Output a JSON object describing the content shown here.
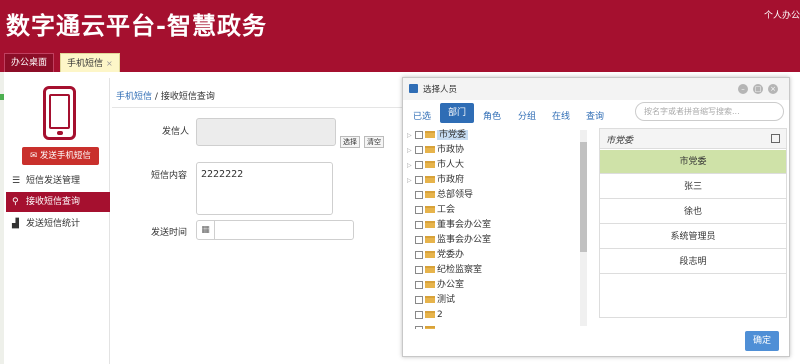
{
  "header": {
    "app_title": "数字通云平台-智慧政务",
    "user_menu": "个人办公"
  },
  "tabs": [
    {
      "label": "办公桌面",
      "active": false
    },
    {
      "label": "手机短信",
      "active": true,
      "close": "×"
    }
  ],
  "sidebar": {
    "send_button": "发送手机短信",
    "items": [
      {
        "label": "短信发送管理",
        "icon": "list-icon",
        "active": false
      },
      {
        "label": "接收短信查询",
        "icon": "search-icon",
        "active": true
      },
      {
        "label": "发送短信统计",
        "icon": "bar-chart-icon",
        "active": false
      }
    ]
  },
  "breadcrumb": {
    "link": "手机短信",
    "separator": "/",
    "current": "接收短信查询"
  },
  "form": {
    "sender_label": "发信人",
    "sender_value": "",
    "select_button": "选择",
    "clear_button": "清空",
    "content_label": "短信内容",
    "content_value": "2222222",
    "time_label": "发送时间",
    "time_value": ""
  },
  "dialog": {
    "title": "选择人员",
    "tabs": [
      "已选",
      "部门",
      "角色",
      "分组",
      "在线",
      "查询"
    ],
    "active_tab": "部门",
    "search_placeholder": "按名字或者拼音缩写搜索...",
    "tree": [
      {
        "label": "市党委",
        "expandable": true,
        "selected": true
      },
      {
        "label": "市政协",
        "expandable": true,
        "selected": false
      },
      {
        "label": "市人大",
        "expandable": true,
        "selected": false
      },
      {
        "label": "市政府",
        "expandable": true,
        "selected": false
      },
      {
        "label": "总部领导",
        "expandable": false,
        "selected": false
      },
      {
        "label": "工会",
        "expandable": false,
        "selected": false
      },
      {
        "label": "董事会办公室",
        "expandable": false,
        "selected": false
      },
      {
        "label": "监事会办公室",
        "expandable": false,
        "selected": false
      },
      {
        "label": "党委办",
        "expandable": false,
        "selected": false
      },
      {
        "label": "纪检监察室",
        "expandable": false,
        "selected": false
      },
      {
        "label": "办公室",
        "expandable": false,
        "selected": false
      },
      {
        "label": "测试",
        "expandable": false,
        "selected": false
      },
      {
        "label": "2",
        "expandable": false,
        "selected": false
      },
      {
        "label": "",
        "expandable": false,
        "selected": false
      }
    ],
    "panel_header": "市党委",
    "people": [
      {
        "name": "市党委",
        "selected": true
      },
      {
        "name": "张三",
        "selected": false
      },
      {
        "name": "徐也",
        "selected": false
      },
      {
        "name": "系统管理员",
        "selected": false
      },
      {
        "name": "段志明",
        "selected": false
      }
    ],
    "confirm_button": "确定"
  },
  "colors": {
    "brand": "#a5102f",
    "accent_blue": "#2f6db5",
    "selected_green": "#cfe2a8",
    "send_button": "#c9302c"
  }
}
